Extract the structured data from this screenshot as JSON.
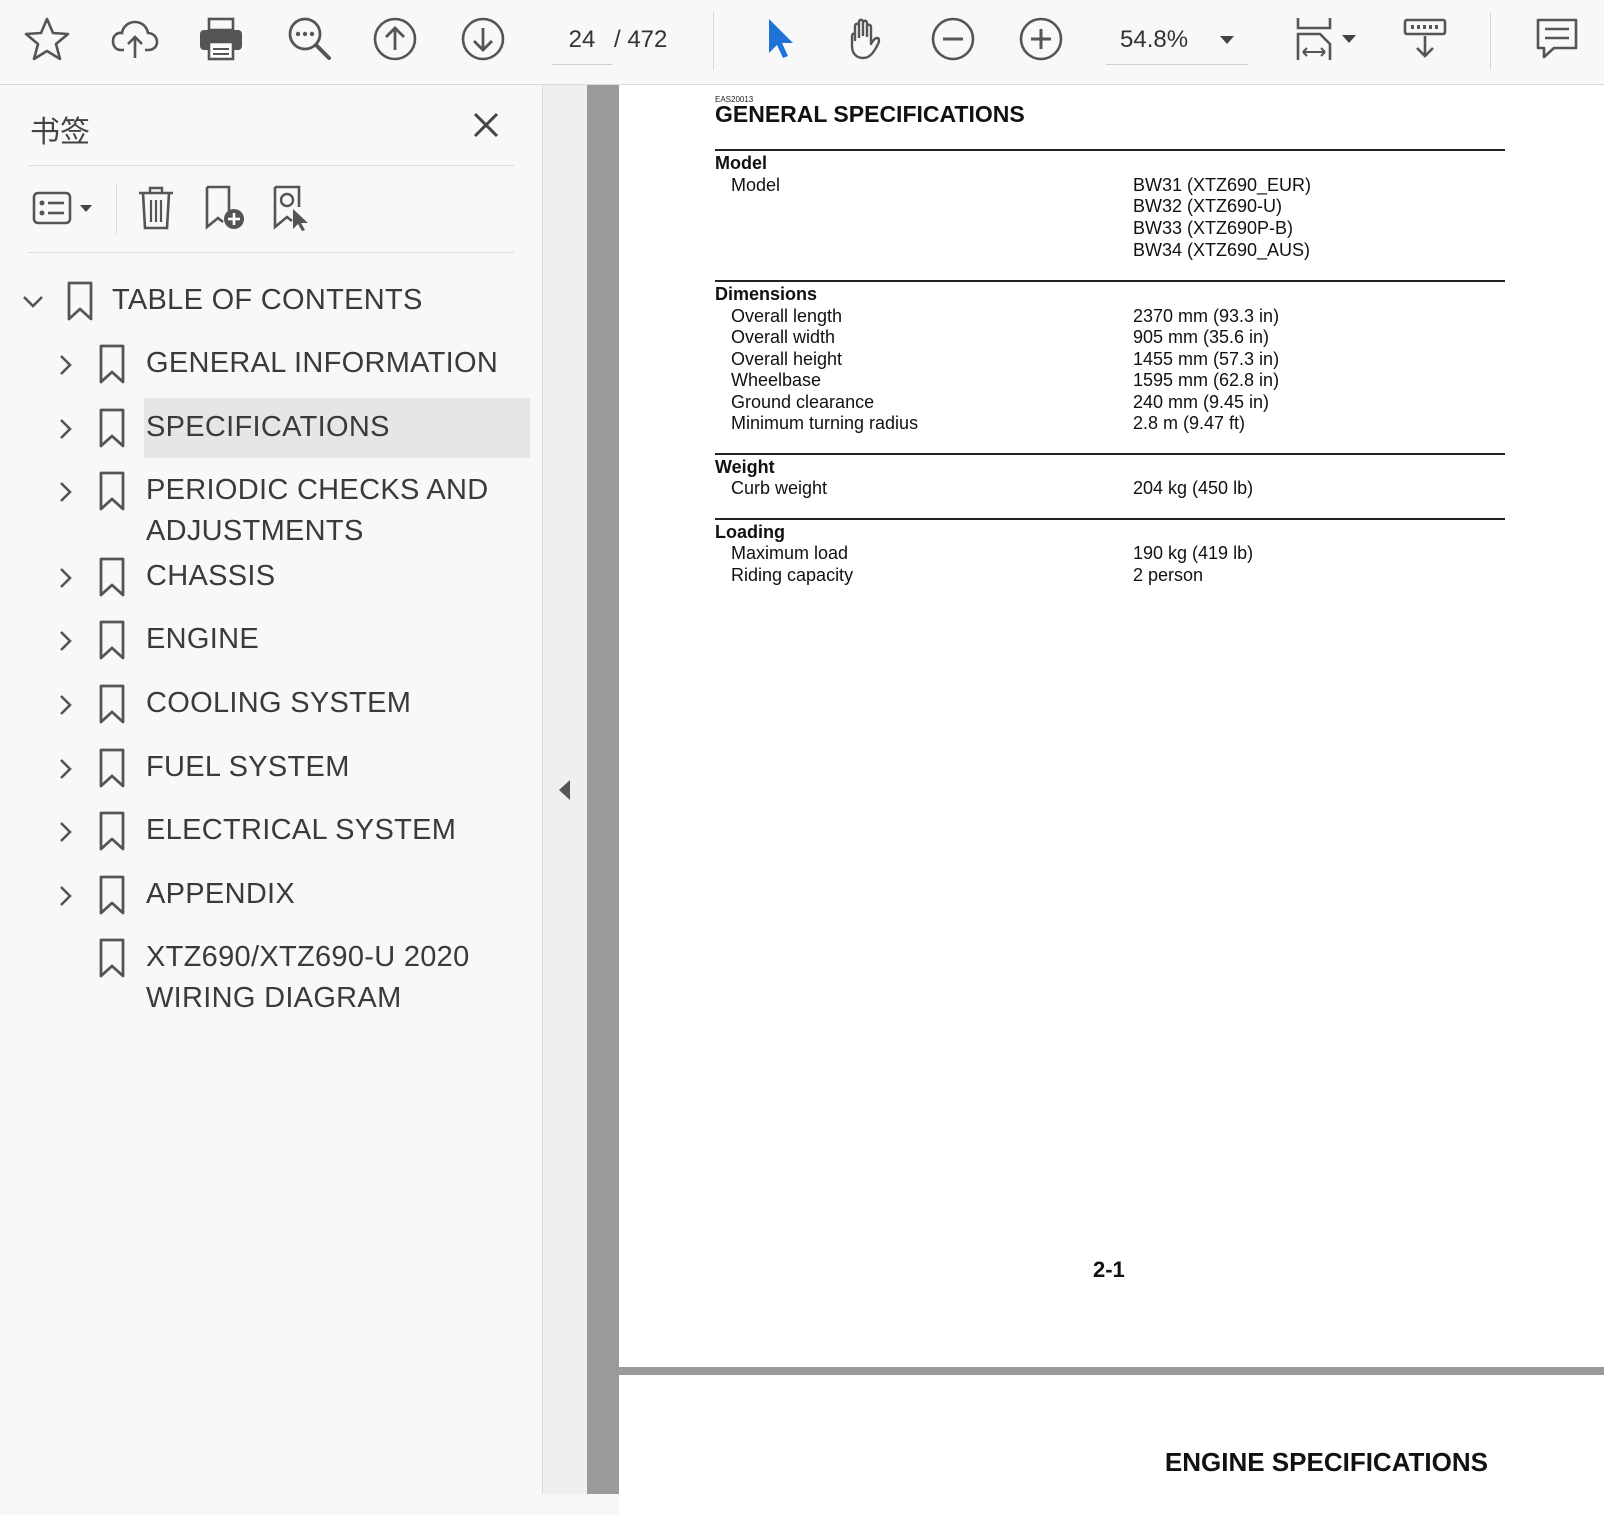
{
  "toolbar": {
    "icons": [
      "star-icon",
      "cloud-upload-icon",
      "print-icon",
      "search-zoom-icon",
      "arrow-up-circle-icon",
      "arrow-down-circle-icon",
      "select-cursor-icon",
      "hand-icon",
      "zoom-out-icon",
      "zoom-in-icon",
      "fit-page-icon",
      "read-mode-icon",
      "comment-icon"
    ],
    "current_page": "24",
    "total_pages": "/ 472",
    "zoom": "54.8%",
    "accent": "#1f73d6"
  },
  "panel": {
    "title": "书签",
    "bookmarks": [
      {
        "label": "TABLE OF CONTENTS",
        "expanded": true
      },
      {
        "label": "GENERAL INFORMATION"
      },
      {
        "label": "SPECIFICATIONS",
        "selected": true
      },
      {
        "label_line1": "PERIODIC CHECKS AND",
        "label_line2": "ADJUSTMENTS"
      },
      {
        "label": "CHASSIS"
      },
      {
        "label": "ENGINE"
      },
      {
        "label": "COOLING SYSTEM"
      },
      {
        "label": "FUEL SYSTEM"
      },
      {
        "label": "ELECTRICAL SYSTEM"
      },
      {
        "label": "APPENDIX"
      },
      {
        "label_line1": "XTZ690/XTZ690-U 2020",
        "label_line2": "WIRING DIAGRAM"
      }
    ]
  },
  "document": {
    "code": "EAS20013",
    "title": "GENERAL SPECIFICATIONS",
    "sections": {
      "model": {
        "heading": "Model",
        "label": "Model",
        "values": [
          "BW31 (XTZ690_EUR)",
          "BW32 (XTZ690-U)",
          "BW33 (XTZ690P-B)",
          "BW34 (XTZ690_AUS)"
        ]
      },
      "dimensions": {
        "heading": "Dimensions",
        "rows": [
          {
            "label": "Overall length",
            "value": "2370 mm (93.3 in)"
          },
          {
            "label": "Overall width",
            "value": "905 mm (35.6 in)"
          },
          {
            "label": "Overall height",
            "value": "1455 mm (57.3 in)"
          },
          {
            "label": "Wheelbase",
            "value": "1595 mm (62.8 in)"
          },
          {
            "label": "Ground clearance",
            "value": "240 mm (9.45 in)"
          },
          {
            "label": "Minimum turning radius",
            "value": "2.8 m (9.47 ft)"
          }
        ]
      },
      "weight": {
        "heading": "Weight",
        "rows": [
          {
            "label": "Curb weight",
            "value": "204 kg (450 lb)"
          }
        ]
      },
      "loading": {
        "heading": "Loading",
        "rows": [
          {
            "label": "Maximum load",
            "value": "190 kg (419 lb)"
          },
          {
            "label": "Riding capacity",
            "value": "2 person"
          }
        ]
      }
    },
    "page_number": "2-1",
    "next_page_title": "ENGINE SPECIFICATIONS"
  }
}
